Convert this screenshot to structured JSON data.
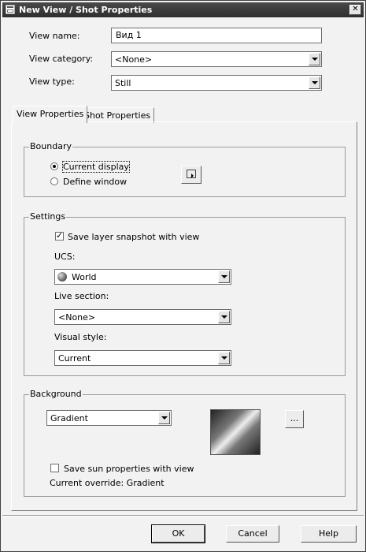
{
  "window": {
    "title": "New View / Shot Properties",
    "close_glyph": "✕",
    "title_icon": "dialog-icon"
  },
  "fields": {
    "view_name": {
      "label": "View name:",
      "value": "Вид 1"
    },
    "view_category": {
      "label": "View category:",
      "value": "<None>"
    },
    "view_type": {
      "label": "View type:",
      "value": "Still"
    }
  },
  "tabs": [
    {
      "label": "View Properties",
      "active": true
    },
    {
      "label": "Shot Properties",
      "active": false
    }
  ],
  "boundary": {
    "legend": "Boundary",
    "options": [
      {
        "label": "Current display",
        "selected": true
      },
      {
        "label": "Define window",
        "selected": false
      }
    ],
    "pick_icon": "define-window-icon"
  },
  "settings": {
    "legend": "Settings",
    "save_layer_snapshot": {
      "label": "Save layer snapshot with view",
      "checked": true
    },
    "ucs": {
      "label": "UCS:",
      "value": "World",
      "icon": "globe-icon"
    },
    "live_section": {
      "label": "Live section:",
      "value": "<None>"
    },
    "visual_style": {
      "label": "Visual style:",
      "value": "Current"
    }
  },
  "background": {
    "legend": "Background",
    "type": "Gradient",
    "browse_label": "...",
    "save_sun": {
      "label": "Save sun properties with view",
      "checked": false
    },
    "current_override": "Current override: Gradient"
  },
  "buttons": {
    "ok": "OK",
    "cancel": "Cancel",
    "help": "Help"
  }
}
